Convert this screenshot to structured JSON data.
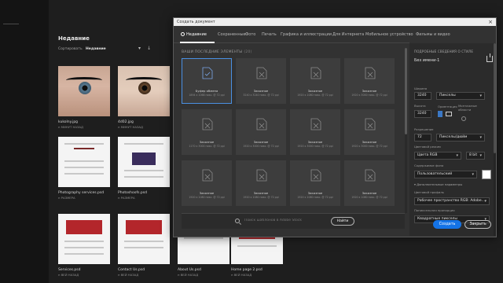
{
  "home": {
    "title": "Недавние",
    "sort_label": "Сортировать",
    "sort_value": "Недавние",
    "sort_chevron": "▾",
    "sort_direction": "↓",
    "items": [
      {
        "name": "kukolny.jpg",
        "date": "н МИНУТ НАЗАД"
      },
      {
        "name": "4d02.jpg",
        "date": "н МИНУТ НАЗАД"
      },
      {
        "name": "Photography services.psd",
        "date": "н РАЗМЕРА"
      },
      {
        "name": "Photoshoofs.psd",
        "date": "н РАЗМЕРА"
      },
      {
        "name": "Services.psd",
        "date": "н ВЕЙ НАЗАД"
      },
      {
        "name": "Contact Us.psd",
        "date": "н ВЕЙ НАЗАД"
      },
      {
        "name": "About Us.psd",
        "date": "н ВЕЙ НАЗАД"
      },
      {
        "name": "Home page 2.psd",
        "date": "н ВЕЙ НАЗАД"
      }
    ]
  },
  "dialog": {
    "title": "Создать документ",
    "close": "×",
    "tabs": [
      {
        "label": "Недавние"
      },
      {
        "label": "Сохраненные"
      },
      {
        "label": "Фото"
      },
      {
        "label": "Печать"
      },
      {
        "label": "Графика и иллюстрации"
      },
      {
        "label": "Для Интернета"
      },
      {
        "label": "Мобильное устройство"
      },
      {
        "label": "Фильмы и видео"
      }
    ],
    "recent_heading": "ВАШИ ПОСЛЕДНИЕ ЭЛЕМЕНТЫ",
    "recent_count": "(20)",
    "tiles": [
      {
        "name": "Буфер обмена",
        "meta": "1894 x 1068 пикс. @ 72 ppi"
      },
      {
        "name": "Заказное",
        "meta": "3240 x 3240 пикс. @ 72 ppi"
      },
      {
        "name": "Заказное",
        "meta": "1920 x 1080 пикс. @ 72 ppi"
      },
      {
        "name": "Заказное",
        "meta": "1920 x 3000 пикс. @ 72 ppi"
      },
      {
        "name": "Заказное",
        "meta": "1170 x 3000 пикс. @ 72 ppi"
      },
      {
        "name": "Заказное",
        "meta": "1920 x 3000 пикс. @ 72 ppi"
      },
      {
        "name": "Заказное",
        "meta": "1920 x 3000 пикс. @ 72 ppi"
      },
      {
        "name": "Заказное",
        "meta": "1920 x 3000 пикс. @ 72 ppi"
      },
      {
        "name": "Заказное",
        "meta": "1920 x 1080 пикс. @ 72 ppi"
      },
      {
        "name": "Заказное",
        "meta": "1920 x 1080 пикс. @ 72 ppi"
      },
      {
        "name": "Заказное",
        "meta": "1920 x 1080 пикс. @ 72 ppi"
      },
      {
        "name": "Заказное",
        "meta": "1920 x 1080 пикс. @ 72 ppi"
      }
    ],
    "search": {
      "placeholder": "Поиск шаблонов в Adobe Stock",
      "button": "Найти"
    },
    "panel": {
      "section_title": "ПОДРОБНЫЕ СВЕДЕНИЯ О СТИЛЕ",
      "doc_name": "Без имени-1",
      "width_label": "Ширина",
      "width_value": "3240",
      "width_unit": "Пикселы",
      "height_label": "Высота",
      "height_value": "3240",
      "orientation_label": "Ориентация",
      "artboards_label": "Монтажные области",
      "resolution_label": "Разрешение",
      "resolution_value": "72",
      "resolution_unit": "Пикселы/дюйм",
      "color_mode_label": "Цветовой режим",
      "color_mode_value": "Цвета RGB",
      "bit_depth_value": "8 bit",
      "background_label": "Содержимое фона",
      "background_value": "Пользовательский",
      "background_color": "#ffffff",
      "advanced_label": "Дополнительные параметры",
      "color_profile_label": "Цветовой профиль",
      "color_profile_value": "Рабочее пространство RGB: Adobe...",
      "pixel_aspect_label": "Попиксельная пропорция",
      "pixel_aspect_value": "Квадратные пикселы",
      "create_button": "Создать",
      "close_button": "Закрыть",
      "chevron": "▾",
      "expand_arrow": "▾"
    }
  },
  "colors": {
    "accent": "#1473e6",
    "selected_border": "#4a90e2",
    "dialog_bg": "#323232",
    "panel_bg": "#2b2b2b"
  }
}
